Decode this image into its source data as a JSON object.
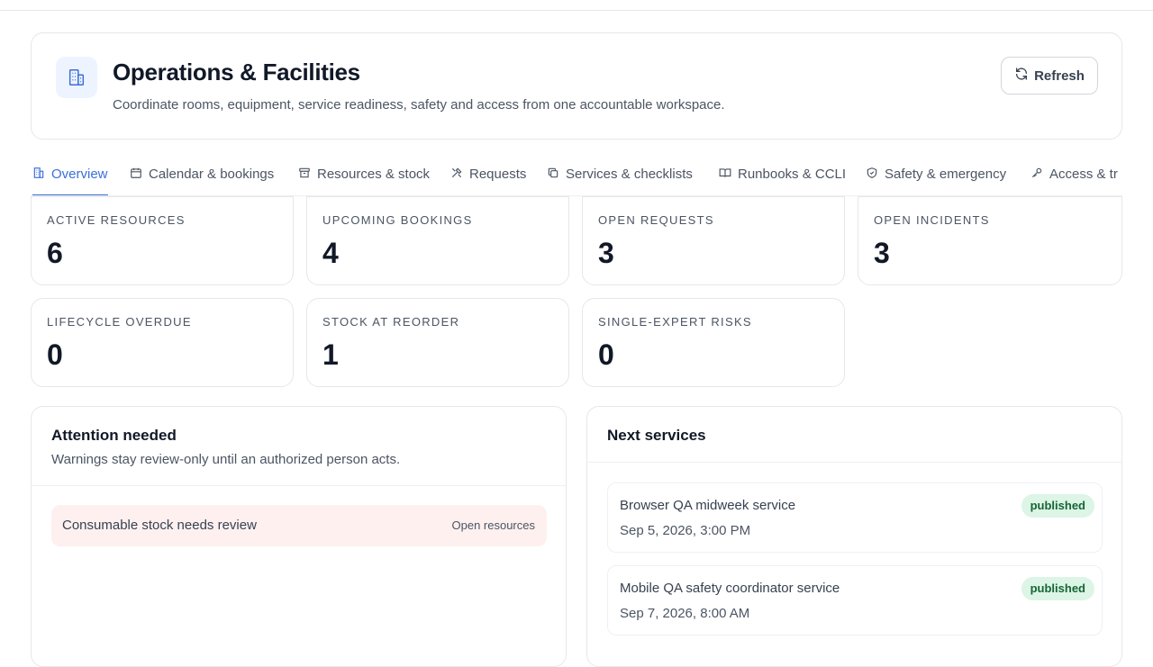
{
  "header": {
    "title": "Operations & Facilities",
    "subtitle": "Coordinate rooms, equipment, service readiness, safety and access from one accountable workspace.",
    "icon": "building-icon",
    "refresh_label": "Refresh"
  },
  "tabs": [
    {
      "label": "Overview",
      "icon": "building-icon",
      "active": true
    },
    {
      "label": "Calendar & bookings",
      "icon": "calendar-icon"
    },
    {
      "label": "Resources & stock",
      "icon": "archive-icon"
    },
    {
      "label": "Requests",
      "icon": "tools-icon"
    },
    {
      "label": "Services & checklists",
      "icon": "copy-icon"
    },
    {
      "label": "Runbooks & CCLI",
      "icon": "book-icon"
    },
    {
      "label": "Safety & emergency",
      "icon": "shield-icon"
    },
    {
      "label": "Access & tr",
      "icon": "key-icon"
    }
  ],
  "stats": [
    {
      "label": "ACTIVE RESOURCES",
      "value": "6"
    },
    {
      "label": "UPCOMING BOOKINGS",
      "value": "4"
    },
    {
      "label": "OPEN REQUESTS",
      "value": "3"
    },
    {
      "label": "OPEN INCIDENTS",
      "value": "3"
    },
    {
      "label": "LIFECYCLE OVERDUE",
      "value": "0"
    },
    {
      "label": "STOCK AT REORDER",
      "value": "1"
    },
    {
      "label": "SINGLE-EXPERT RISKS",
      "value": "0"
    }
  ],
  "attention": {
    "title": "Attention needed",
    "subtitle": "Warnings stay review-only until an authorized person acts.",
    "items": [
      {
        "text": "Consumable stock needs review",
        "link": "Open resources"
      }
    ]
  },
  "next_services": {
    "title": "Next services",
    "items": [
      {
        "name": "Browser QA midweek service",
        "date": "Sep 5, 2026, 3:00 PM",
        "status": "published"
      },
      {
        "name": "Mobile QA safety coordinator service",
        "date": "Sep 7, 2026, 8:00 AM",
        "status": "published"
      }
    ]
  },
  "colors": {
    "accent": "#3b6fd8",
    "alert_bg": "#fdf0ef",
    "badge_bg": "#dcf5e6",
    "badge_text": "#166534"
  }
}
